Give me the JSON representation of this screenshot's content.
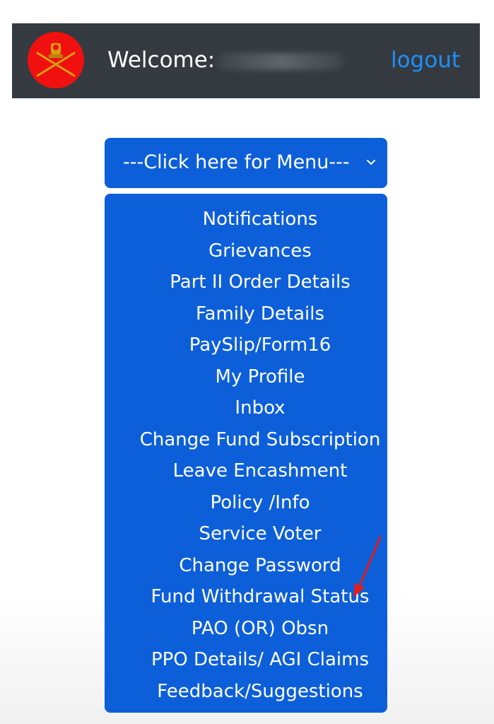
{
  "header": {
    "welcome_label": "Welcome:",
    "logout_label": "logout",
    "logo_icon": "army-emblem-icon"
  },
  "menu": {
    "toggle_label": "---Click here for Menu---",
    "items": [
      "Notifications",
      "Grievances",
      "Part II Order Details",
      "Family Details",
      "PaySlip/Form16",
      "My Profile",
      "Inbox",
      "Change Fund Subscription",
      "Leave Encashment",
      "Policy /Info",
      "Service Voter",
      "Change Password",
      "Fund Withdrawal Status",
      "PAO (OR) Obsn",
      "PPO Details/ AGI Claims",
      "Feedback/Suggestions"
    ]
  },
  "colors": {
    "navbar_bg": "#343a40",
    "menu_bg": "#0d5fd9",
    "logout_link": "#1e90ff",
    "logo_bg": "#f01010",
    "annotation_arrow": "#e31b1b"
  }
}
